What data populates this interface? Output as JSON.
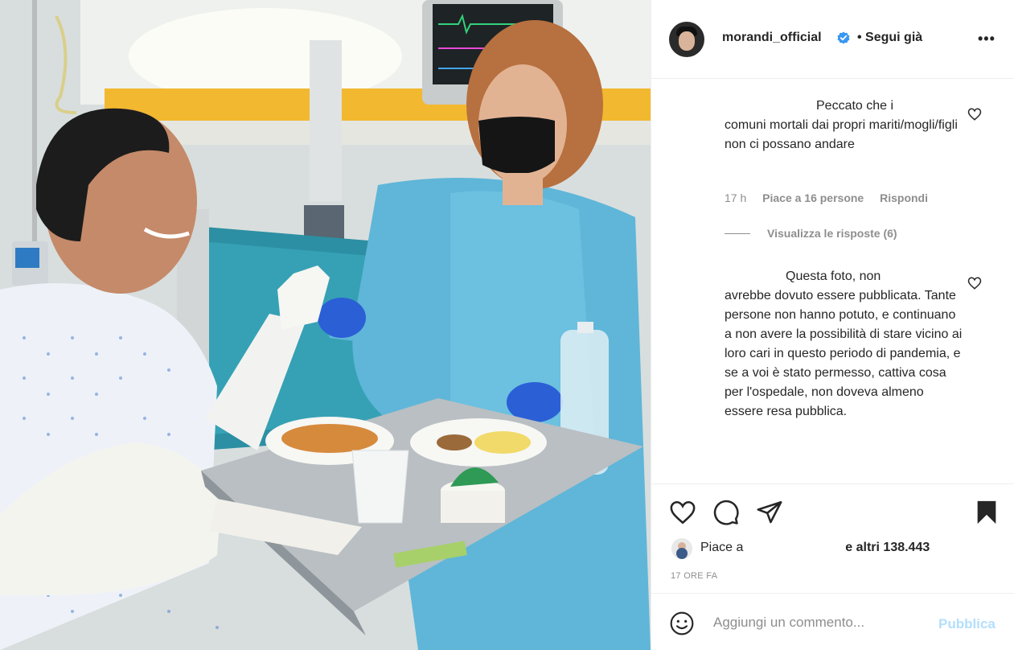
{
  "post": {
    "username": "morandi_official",
    "follow_status": "• Segui già",
    "more_label": "•••"
  },
  "comments": [
    {
      "text": "Peccato che i\ncomuni mortali dai propri mariti/mogli/figli non ci possano andare",
      "time": "17 h",
      "likes": "Piace a 16 persone",
      "reply": "Rispondi",
      "view_replies": "Visualizza le risposte (6)"
    },
    {
      "text": "Questa foto, non\navrebbe dovuto essere pubblicata. Tante persone non hanno potuto, e continuano a non avere la possibilità di stare vicino ai loro cari in questo periodo di pandemia, e se a voi è stato permesso, cattiva cosa per l'ospedale, non doveva almeno essere resa pubblica."
    }
  ],
  "likes": {
    "prefix": "Piace a",
    "suffix": "e altri 138.443"
  },
  "timestamp": "17 ORE FA",
  "add_comment": {
    "placeholder": "Aggiungi un commento...",
    "publish_label": "Pubblica"
  },
  "icons": {
    "like": "heart-icon",
    "comment": "comment-icon",
    "share": "paper-plane-icon",
    "save": "bookmark-icon",
    "emoji": "emoji-icon",
    "verified": "verified-badge-icon",
    "more": "more-options-icon"
  },
  "colors": {
    "verified_blue": "#3897f0",
    "publish_disabled": "#b2dffc",
    "secondary_text": "#8e8e8e"
  }
}
